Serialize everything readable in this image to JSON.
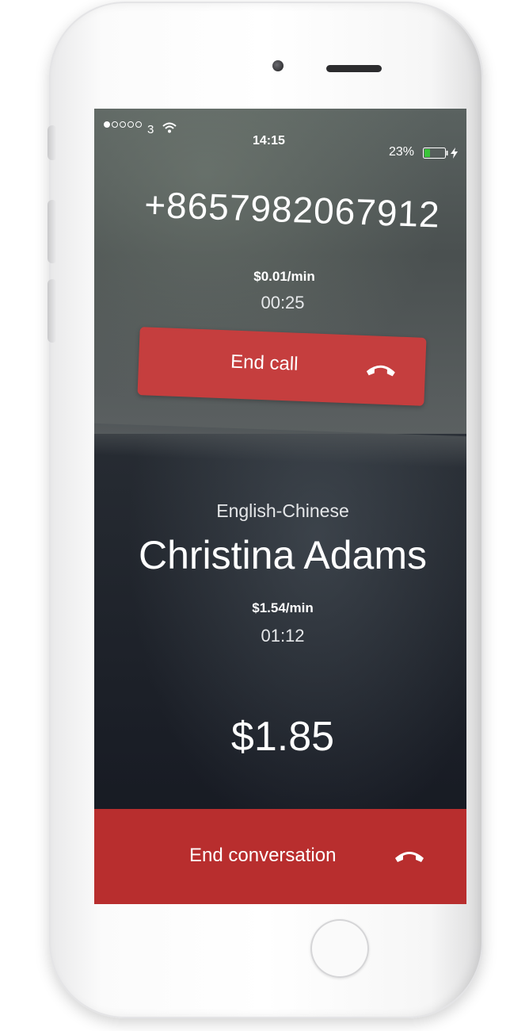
{
  "status_bar": {
    "carrier": "3",
    "time": "14:15",
    "battery": "23%"
  },
  "call": {
    "phone_number": "+8657982067912",
    "rate": "$0.01/min",
    "duration": "00:25",
    "end_label": "End call"
  },
  "interpreter": {
    "language_pair": "English-Chinese",
    "name": "Christina Adams",
    "rate": "$1.54/min",
    "duration": "01:12",
    "total": "$1.85",
    "end_label": "End conversation"
  },
  "colors": {
    "end_call": "#c53e3e",
    "end_conversation": "#b82e2e",
    "battery_level": "#3ac33a"
  }
}
